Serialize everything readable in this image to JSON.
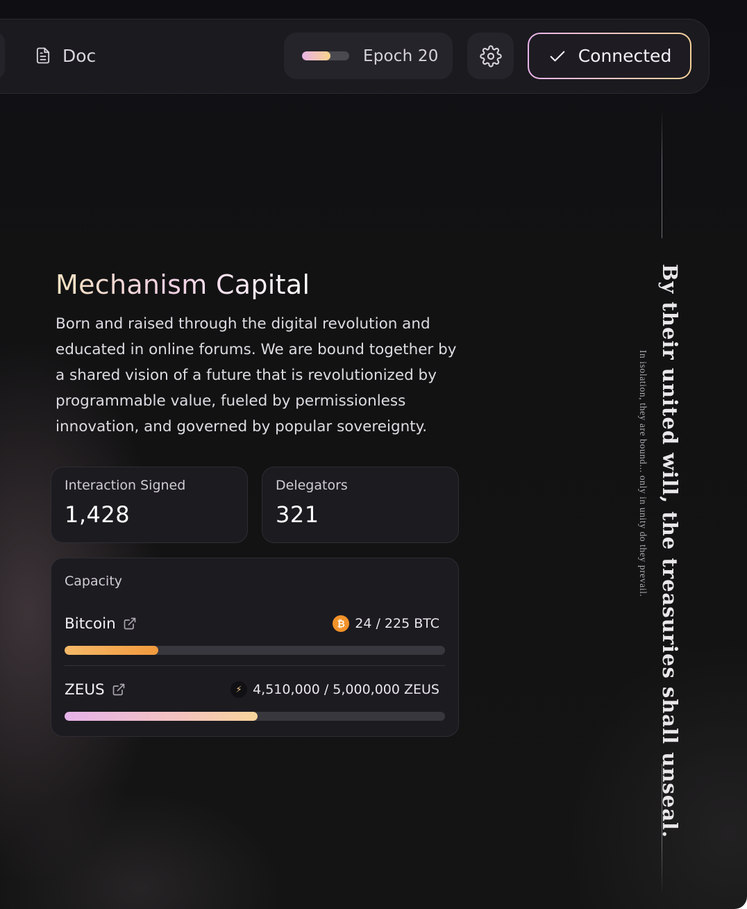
{
  "topbar": {
    "doc_label": "Doc",
    "epoch_label": "Epoch 20",
    "epoch_progress": 0.6,
    "connected_label": "Connected"
  },
  "profile": {
    "title": "Mechanism Capital",
    "description": "Born and raised through the digital revolution and educated in online forums. We are bound together by a shared vision of a future that is revolutionized by programmable value, fueled by permissionless innovation, and governed by popular sovereignty."
  },
  "stats": {
    "interaction_label": "Interaction Signed",
    "interaction_value": "1,428",
    "delegators_label": "Delegators",
    "delegators_value": "321"
  },
  "capacity": {
    "title": "Capacity",
    "items": [
      {
        "name": "Bitcoin",
        "amount": "24 / 225 BTC",
        "coin_icon": "bitcoin-coin-icon",
        "fill": 0.247
      },
      {
        "name": "ZEUS",
        "amount": "4,510,000 / 5,000,000 ZEUS",
        "coin_icon": "zeus-coin-icon",
        "fill": 0.507
      }
    ]
  },
  "motto": {
    "main": "By their united will, the treasuries shall unseal.",
    "sub": "In isolation, they are bound... only in unity do they prevail."
  },
  "colors": {
    "background": "#121213",
    "card": "#1c1b20",
    "accent_pink": "#e9b3e6",
    "accent_gold": "#f7d58a",
    "bitcoin_orange": "#f2922a"
  }
}
